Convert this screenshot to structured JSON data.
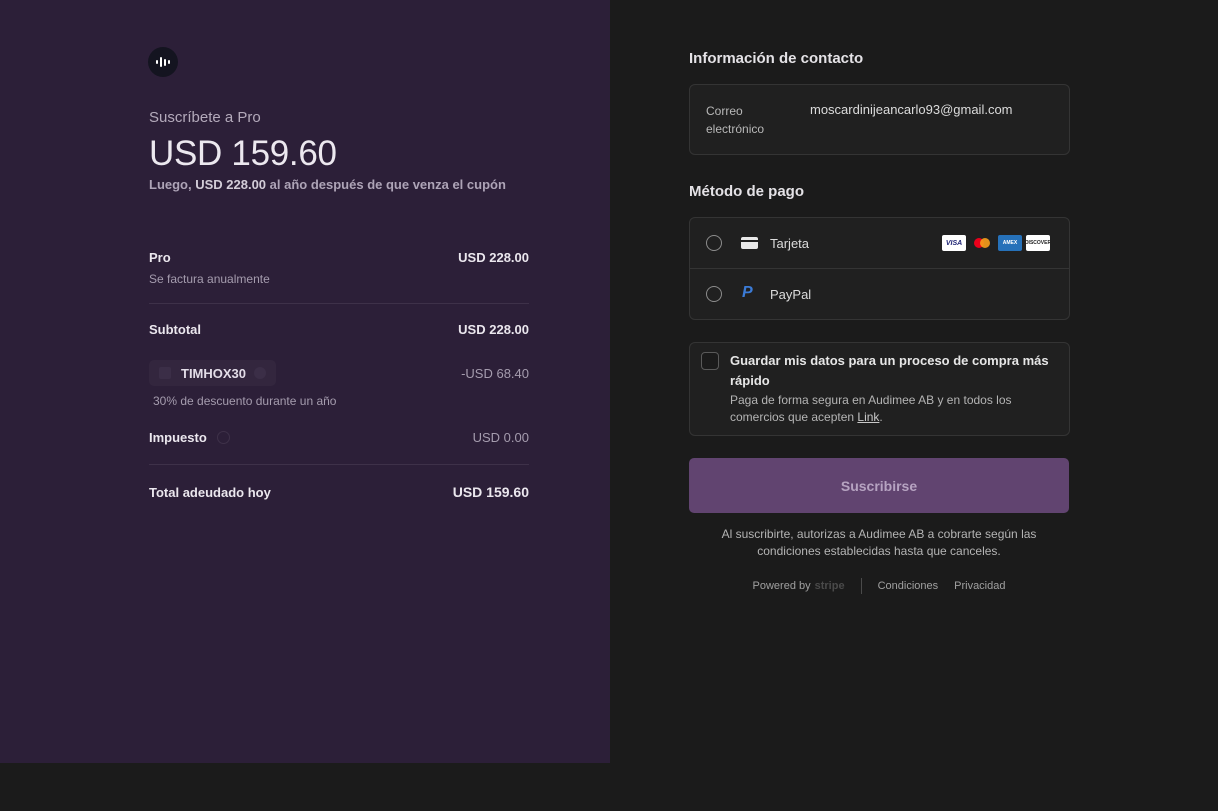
{
  "summary": {
    "subscribe_to": "Suscríbete a Pro",
    "price": "USD 159.60",
    "after_prefix": "Luego, ",
    "after_amount": "USD 228.00",
    "after_suffix": " al año después de que venza el cupón",
    "items": {
      "pro_label": "Pro",
      "pro_sub": "Se factura anualmente",
      "pro_value": "USD 228.00",
      "subtotal_label": "Subtotal",
      "subtotal_value": "USD 228.00",
      "coupon_code": "TIMHOX30",
      "coupon_value": "-USD 68.40",
      "coupon_desc": "30% de descuento durante un año",
      "tax_label": "Impuesto",
      "tax_value": "USD 0.00",
      "total_label": "Total adeudado hoy",
      "total_value": "USD 159.60"
    }
  },
  "contact": {
    "title": "Información de contacto",
    "email_label": "Correo electrónico",
    "email_value": "moscardinijeancarlo93@gmail.com"
  },
  "payment": {
    "title": "Método de pago",
    "card_label": "Tarjeta",
    "paypal_label": "PayPal",
    "brands": [
      "VISA",
      "mastercard",
      "AMEX",
      "DISCOVER"
    ]
  },
  "save": {
    "title": "Guardar mis datos para un proceso de compra más rápido",
    "desc_prefix": "Paga de forma segura en Audimee AB y en todos los comercios que acepten ",
    "desc_link": "Link",
    "desc_suffix": "."
  },
  "subscribe_label": "Suscribirse",
  "legal": "Al suscribirte, autorizas a Audimee AB a cobrarte según las condiciones establecidas hasta que canceles.",
  "footer": {
    "powered_by": "Powered by",
    "stripe": "stripe",
    "terms": "Condiciones",
    "privacy": "Privacidad"
  },
  "colors": {
    "left_bg": "#2c1f38",
    "right_bg": "#1b1b1b",
    "button_bg": "#614470"
  }
}
